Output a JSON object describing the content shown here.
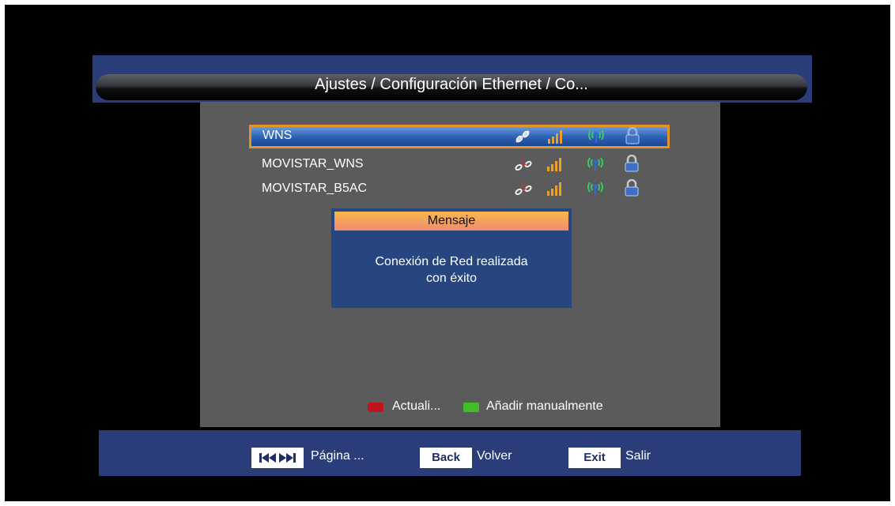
{
  "header": {
    "title": "Ajustes / Configuración Ethernet / Co..."
  },
  "networks": [
    {
      "name": "WNS",
      "selected": true,
      "link_icon": "link-connected-icon",
      "signal_icon": "signal-bars-icon",
      "wireless_icon": "antenna-icon",
      "lock_icon": "lock-icon"
    },
    {
      "name": "MOVISTAR_WNS",
      "selected": false,
      "link_icon": "link-broken-icon",
      "signal_icon": "signal-bars-icon",
      "wireless_icon": "antenna-icon",
      "lock_icon": "lock-icon"
    },
    {
      "name": "MOVISTAR_B5AC",
      "selected": false,
      "link_icon": "link-broken-icon",
      "signal_icon": "signal-bars-icon",
      "wireless_icon": "antenna-icon",
      "lock_icon": "lock-icon"
    }
  ],
  "dialog": {
    "title": "Mensaje",
    "line1": "Conexión de Red realizada",
    "line2": "con éxito"
  },
  "color_keys": {
    "red_label": "Actuali...",
    "green_label": "Añadir manualmente",
    "red_color": "#c0141c",
    "green_color": "#3fbf2a"
  },
  "footer": {
    "page_label": "Página ...",
    "back_key": "Back",
    "back_label": "Volver",
    "exit_key": "Exit",
    "exit_label": "Salir"
  },
  "colors": {
    "band_blue": "#2a3d78",
    "panel_gray": "#5b5b5b",
    "selection_border": "#e2942b"
  }
}
